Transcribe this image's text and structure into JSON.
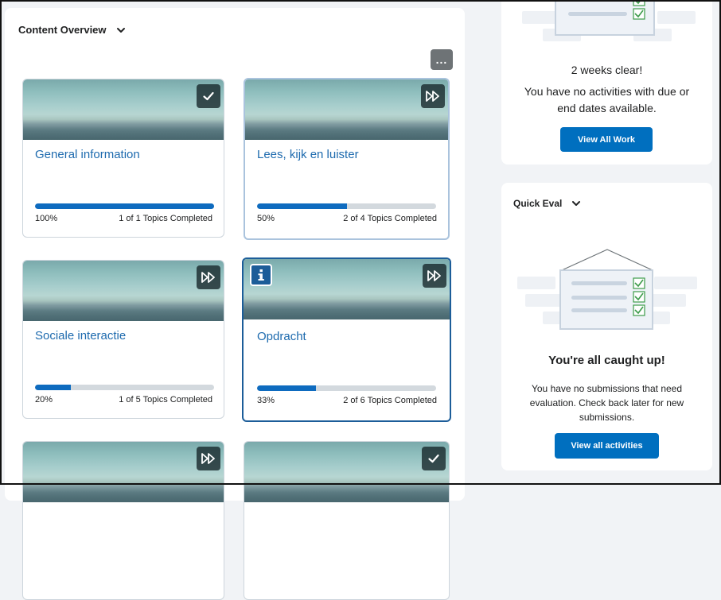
{
  "content_overview": {
    "title": "Content Overview",
    "more_label": "...",
    "cards": [
      {
        "title": "General information",
        "percent_label": "100%",
        "progress": 1.0,
        "completed_label": "1 of 1 Topics Completed",
        "status_icon": "checkmark-icon"
      },
      {
        "title": "Lees, kijk en luister",
        "percent_label": "50%",
        "progress": 0.5,
        "completed_label": "2 of 4 Topics Completed",
        "status_icon": "play-forward-icon"
      },
      {
        "title": "Sociale interactie",
        "percent_label": "20%",
        "progress": 0.2,
        "completed_label": "1 of 5 Topics Completed",
        "status_icon": "play-forward-icon"
      },
      {
        "title": "Opdracht",
        "percent_label": "33%",
        "progress": 0.33,
        "completed_label": "2 of 6 Topics Completed",
        "status_icon": "play-forward-icon",
        "badge_icon": "info-icon"
      },
      {
        "status_icon": "play-forward-icon"
      },
      {
        "status_icon": "checkmark-icon"
      }
    ]
  },
  "work_to_do": {
    "empty_heading": "2 weeks clear!",
    "empty_text": "You have no activities with due or end dates available.",
    "button_label": "View All Work"
  },
  "quick_eval": {
    "title": "Quick Eval",
    "empty_heading": "You're all caught up!",
    "empty_text": "You have no submissions that need evaluation. Check back later for new submissions.",
    "button_label": "View all activities"
  },
  "colors": {
    "accent": "#006fbf",
    "link": "#1d6aae",
    "progress_fill": "#0e6bbf",
    "progress_track": "#d3d9de",
    "page_bg": "#f1f3f6"
  }
}
